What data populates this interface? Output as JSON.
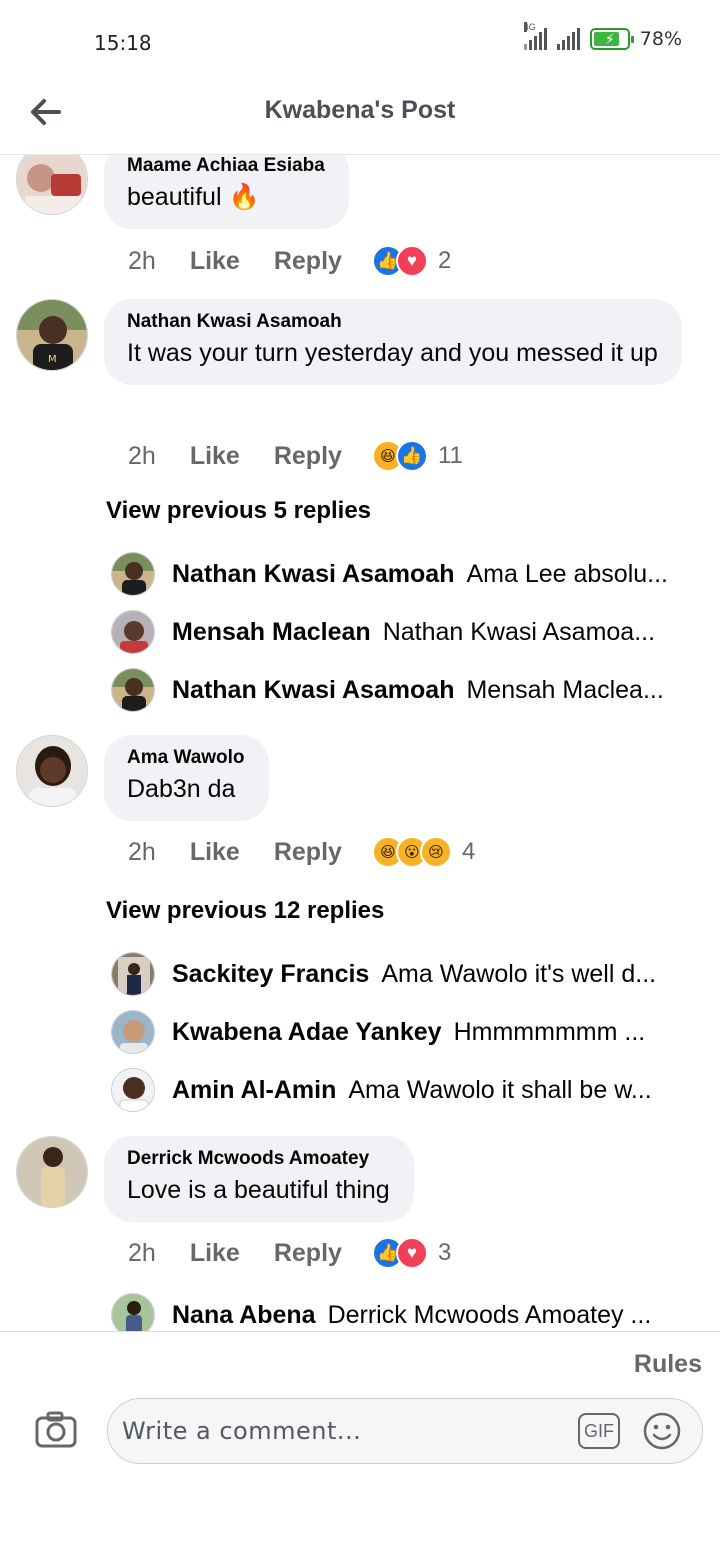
{
  "status_bar": {
    "time": "15:18",
    "network_label": "4G",
    "battery_percent": "78%",
    "battery_level": 0.78
  },
  "header": {
    "title": "Kwabena's Post",
    "back_icon": "arrow-left-icon"
  },
  "comments": [
    {
      "author": "Maame Achiaa Esiaba",
      "text": "beautiful 🔥",
      "time": "2h",
      "like_label": "Like",
      "reply_label": "Reply",
      "reactions": [
        "like",
        "love"
      ],
      "reaction_count": "2"
    },
    {
      "author": "Nathan Kwasi Asamoah",
      "text": "It was your turn yesterday and you messed it up",
      "time": "2h",
      "like_label": "Like",
      "reply_label": "Reply",
      "reactions": [
        "haha",
        "like"
      ],
      "reaction_count": "11",
      "view_previous": "View previous 5 replies",
      "replies": [
        {
          "author": "Nathan Kwasi Asamoah",
          "text": "Ama Lee absolu..."
        },
        {
          "author": "Mensah Maclean",
          "text": "Nathan Kwasi Asamoa..."
        },
        {
          "author": "Nathan Kwasi Asamoah",
          "text": "Mensah Maclea..."
        }
      ]
    },
    {
      "author": "Ama Wawolo",
      "text": "Dab3n da",
      "time": "2h",
      "like_label": "Like",
      "reply_label": "Reply",
      "reactions": [
        "haha",
        "wow",
        "sad"
      ],
      "reaction_count": "4",
      "view_previous": "View previous 12 replies",
      "replies": [
        {
          "author": "Sackitey Francis",
          "text": "Ama Wawolo it's well d..."
        },
        {
          "author": "Kwabena Adae Yankey",
          "text": "Hmmmmmmm ..."
        },
        {
          "author": "Amin Al-Amin",
          "text": "Ama Wawolo it shall be w..."
        }
      ]
    },
    {
      "author": "Derrick Mcwoods Amoatey",
      "text": "Love is a beautiful thing",
      "time": "2h",
      "like_label": "Like",
      "reply_label": "Reply",
      "reactions": [
        "like",
        "love"
      ],
      "reaction_count": "3",
      "replies": [
        {
          "author": "Nana Abena",
          "text": "Derrick Mcwoods Amoatey ..."
        }
      ]
    }
  ],
  "composer": {
    "rules_label": "Rules",
    "placeholder": "Write a comment...",
    "gif_label": "GIF",
    "camera_icon": "camera-icon",
    "emoji_icon": "smiley-icon"
  },
  "colors": {
    "bubble": "#f0f2f5",
    "like_blue": "#1b74e4",
    "love_red": "#f33e58",
    "meta_gray": "#65676b",
    "battery_green": "#3fb53f"
  }
}
